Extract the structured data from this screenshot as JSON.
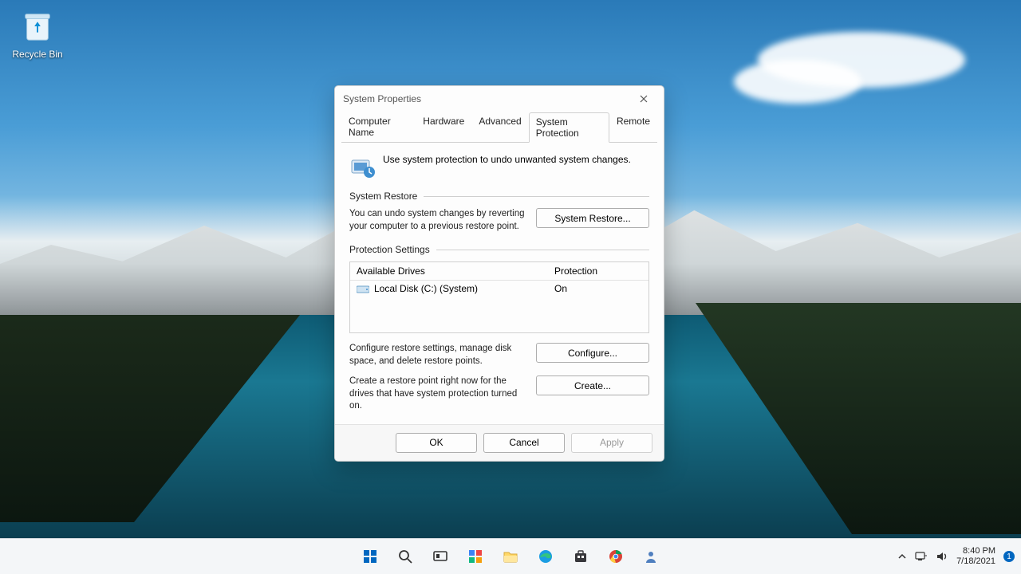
{
  "desktop": {
    "recycle_label": "Recycle Bin"
  },
  "dialog": {
    "title": "System Properties",
    "tabs": [
      "Computer Name",
      "Hardware",
      "Advanced",
      "System Protection",
      "Remote"
    ],
    "active_tab_index": 3,
    "intro_text": "Use system protection to undo unwanted system changes.",
    "group_restore_title": "System Restore",
    "restore_desc": "You can undo system changes by reverting your computer to a previous restore point.",
    "restore_button": "System Restore...",
    "group_settings_title": "Protection Settings",
    "col_drives": "Available Drives",
    "col_protection": "Protection",
    "drive_name": "Local Disk (C:) (System)",
    "drive_status": "On",
    "configure_desc": "Configure restore settings, manage disk space, and delete restore points.",
    "configure_button": "Configure...",
    "create_desc": "Create a restore point right now for the drives that have system protection turned on.",
    "create_button": "Create...",
    "ok": "OK",
    "cancel": "Cancel",
    "apply": "Apply"
  },
  "tray": {
    "time": "8:40 PM",
    "date": "7/18/2021",
    "badge": "1"
  }
}
